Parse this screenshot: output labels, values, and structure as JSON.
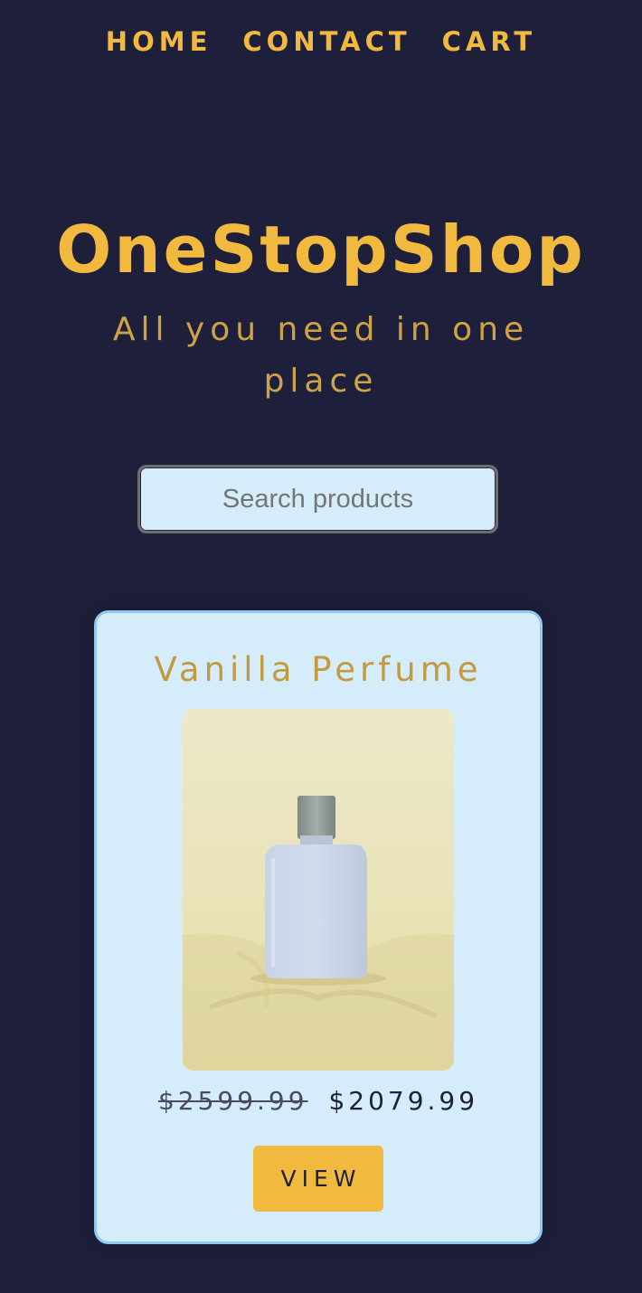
{
  "nav": {
    "home": "HOME",
    "contact": "CONTACT",
    "cart": "CART"
  },
  "header": {
    "title": "OneStopShop",
    "tagline": "All you need in one place"
  },
  "search": {
    "placeholder": "Search products"
  },
  "products": [
    {
      "name": "Vanilla Perfume",
      "image": "perfume-bottle-image",
      "old_price": "$2599.99",
      "price": "$2079.99",
      "button_label": "VIEW"
    }
  ],
  "colors": {
    "background": "#1e1f3b",
    "accent": "#f2b93f",
    "card": "#d5ecfb",
    "card_border": "#8fc9f2"
  }
}
